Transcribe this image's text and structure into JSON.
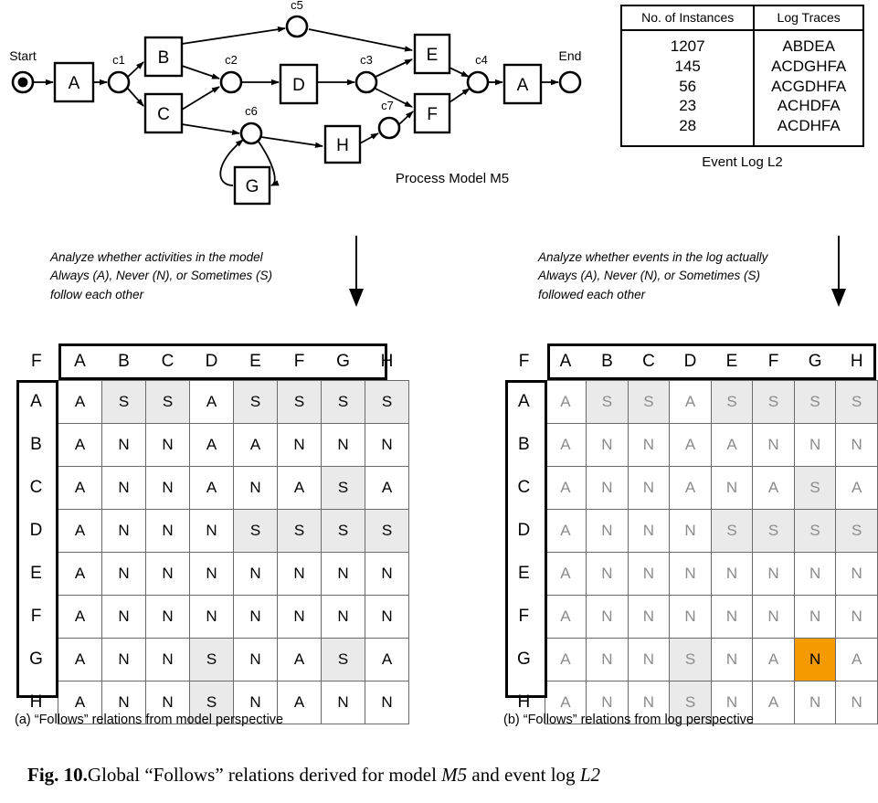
{
  "model": {
    "title": "Process Model M5",
    "start_label": "Start",
    "end_label": "End",
    "activities": [
      "A",
      "B",
      "C",
      "D",
      "E",
      "F",
      "G",
      "H",
      "A"
    ],
    "places": [
      "c1",
      "c2",
      "c3",
      "c4",
      "c5",
      "c6",
      "c7"
    ],
    "nodes": {
      "a1": "A",
      "b": "B",
      "c": "C",
      "d": "D",
      "e": "E",
      "f": "F",
      "g": "G",
      "h": "H",
      "a2": "A"
    },
    "place_labels": {
      "c1": "c1",
      "c2": "c2",
      "c3": "c3",
      "c4": "c4",
      "c5": "c5",
      "c6": "c6",
      "c7": "c7"
    }
  },
  "event_log": {
    "caption": "Event Log L2",
    "headers": [
      "No. of Instances",
      "Log Traces"
    ],
    "instances": [
      "1207",
      "145",
      "56",
      "23",
      "28"
    ],
    "traces": [
      "ABDEA",
      "ACDGHFA",
      "ACGDHFA",
      "ACHDFA",
      "ACDHFA"
    ]
  },
  "annotations": {
    "left": "Analyze whether activities in the model Always (A), Never (N), or Sometimes (S) follow each other",
    "left_lines": [
      "Analyze whether activities in the model",
      "Always (A), Never (N), or Sometimes (S)",
      "follow each other"
    ],
    "right": "Analyze whether events in the log actually Always (A), Never (N), or Sometimes (S) followed each other",
    "right_lines": [
      "Analyze whether events in the log actually",
      "Always (A), Never (N), or Sometimes (S)",
      "followed each other"
    ],
    "arrow_icon": "down-arrow-icon"
  },
  "colors": {
    "highlight": "#f59a00",
    "shaded_cell": "#eaeaea",
    "log_text": "#8b8b8b",
    "border": "#6a6a6a"
  },
  "matrix_model": {
    "caption": "(a) “Follows” relations from model perspective",
    "corner_label": "F",
    "columns": [
      "A",
      "B",
      "C",
      "D",
      "E",
      "F",
      "G",
      "H"
    ],
    "rows": [
      "A",
      "B",
      "C",
      "D",
      "E",
      "F",
      "G",
      "H"
    ],
    "values": [
      [
        "A",
        "S",
        "S",
        "A",
        "S",
        "S",
        "S",
        "S"
      ],
      [
        "A",
        "N",
        "N",
        "A",
        "A",
        "N",
        "N",
        "N"
      ],
      [
        "A",
        "N",
        "N",
        "A",
        "N",
        "A",
        "S",
        "A"
      ],
      [
        "A",
        "N",
        "N",
        "N",
        "S",
        "S",
        "S",
        "S"
      ],
      [
        "A",
        "N",
        "N",
        "N",
        "N",
        "N",
        "N",
        "N"
      ],
      [
        "A",
        "N",
        "N",
        "N",
        "N",
        "N",
        "N",
        "N"
      ],
      [
        "A",
        "N",
        "N",
        "S",
        "N",
        "A",
        "S",
        "A"
      ],
      [
        "A",
        "N",
        "N",
        "S",
        "N",
        "A",
        "N",
        "N"
      ]
    ],
    "shaded": [
      [
        false,
        true,
        true,
        false,
        true,
        true,
        true,
        true
      ],
      [
        false,
        false,
        false,
        false,
        false,
        false,
        false,
        false
      ],
      [
        false,
        false,
        false,
        false,
        false,
        false,
        true,
        false
      ],
      [
        false,
        false,
        false,
        false,
        true,
        true,
        true,
        true
      ],
      [
        false,
        false,
        false,
        false,
        false,
        false,
        false,
        false
      ],
      [
        false,
        false,
        false,
        false,
        false,
        false,
        false,
        false
      ],
      [
        false,
        false,
        false,
        true,
        false,
        false,
        true,
        false
      ],
      [
        false,
        false,
        false,
        true,
        false,
        false,
        false,
        false
      ]
    ],
    "highlighted": []
  },
  "matrix_log": {
    "caption": "(b) “Follows” relations from log perspective",
    "corner_label": "F",
    "columns": [
      "A",
      "B",
      "C",
      "D",
      "E",
      "F",
      "G",
      "H"
    ],
    "rows": [
      "A",
      "B",
      "C",
      "D",
      "E",
      "F",
      "G",
      "H"
    ],
    "values": [
      [
        "A",
        "S",
        "S",
        "A",
        "S",
        "S",
        "S",
        "S"
      ],
      [
        "A",
        "N",
        "N",
        "A",
        "A",
        "N",
        "N",
        "N"
      ],
      [
        "A",
        "N",
        "N",
        "A",
        "N",
        "A",
        "S",
        "A"
      ],
      [
        "A",
        "N",
        "N",
        "N",
        "S",
        "S",
        "S",
        "S"
      ],
      [
        "A",
        "N",
        "N",
        "N",
        "N",
        "N",
        "N",
        "N"
      ],
      [
        "A",
        "N",
        "N",
        "N",
        "N",
        "N",
        "N",
        "N"
      ],
      [
        "A",
        "N",
        "N",
        "S",
        "N",
        "A",
        "N",
        "A"
      ],
      [
        "A",
        "N",
        "N",
        "S",
        "N",
        "A",
        "N",
        "N"
      ]
    ],
    "shaded": [
      [
        false,
        true,
        true,
        false,
        true,
        true,
        true,
        true
      ],
      [
        false,
        false,
        false,
        false,
        false,
        false,
        false,
        false
      ],
      [
        false,
        false,
        false,
        false,
        false,
        false,
        true,
        false
      ],
      [
        false,
        false,
        false,
        false,
        true,
        true,
        true,
        true
      ],
      [
        false,
        false,
        false,
        false,
        false,
        false,
        false,
        false
      ],
      [
        false,
        false,
        false,
        false,
        false,
        false,
        false,
        false
      ],
      [
        false,
        false,
        false,
        true,
        false,
        false,
        false,
        false
      ],
      [
        false,
        false,
        false,
        true,
        false,
        false,
        false,
        false
      ]
    ],
    "highlighted": [
      [
        false,
        false,
        false,
        false,
        false,
        false,
        false,
        false
      ],
      [
        false,
        false,
        false,
        false,
        false,
        false,
        false,
        false
      ],
      [
        false,
        false,
        false,
        false,
        false,
        false,
        false,
        false
      ],
      [
        false,
        false,
        false,
        false,
        false,
        false,
        false,
        false
      ],
      [
        false,
        false,
        false,
        false,
        false,
        false,
        false,
        false
      ],
      [
        false,
        false,
        false,
        false,
        false,
        false,
        false,
        false
      ],
      [
        false,
        false,
        false,
        false,
        false,
        false,
        true,
        false
      ],
      [
        false,
        false,
        false,
        false,
        false,
        false,
        false,
        false
      ]
    ]
  },
  "figure_caption": {
    "prefix": "Fig. 10.",
    "text_1": "Global “Follows” relations derived for model ",
    "italic_1": "M5",
    "text_2": " and event log ",
    "italic_2": "L2"
  }
}
